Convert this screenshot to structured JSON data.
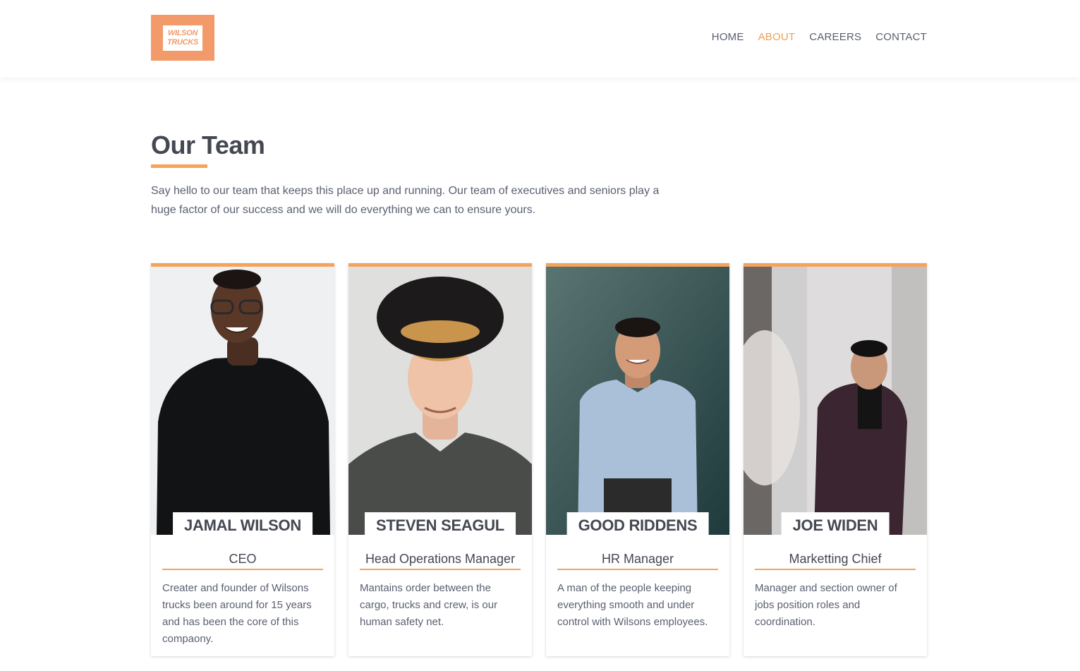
{
  "logo": {
    "line1": "WILSON",
    "line2": "TRUCKS"
  },
  "nav": {
    "home": "HOME",
    "about": "ABOUT",
    "careers": "CAREERS",
    "contact": "CONTACT"
  },
  "main": {
    "title": "Our Team",
    "intro": "Say hello to our team that keeps this place up and running. Our team of executives and seniors play a huge factor of our success and we will do everything we can to ensure yours."
  },
  "team": [
    {
      "name": "JAMAL WILSON",
      "role": "CEO",
      "description": "Creater and founder of Wilsons trucks been around for 15 years and has been the core of this compaony."
    },
    {
      "name": "STEVEN SEAGUL",
      "role": "Head Operations Manager",
      "description": "Mantains order between the cargo, trucks and crew, is our human safety net."
    },
    {
      "name": "GOOD RIDDENS",
      "role": "HR Manager",
      "description": "A man of the people keeping everything smooth and under control with Wilsons employees."
    },
    {
      "name": "JOE WIDEN",
      "role": "Marketting Chief",
      "description": "Manager and section owner of jobs position roles and coordination."
    }
  ],
  "colors": {
    "accent": "#f5a25a",
    "logo": "#f29a6a",
    "text": "#444852"
  }
}
